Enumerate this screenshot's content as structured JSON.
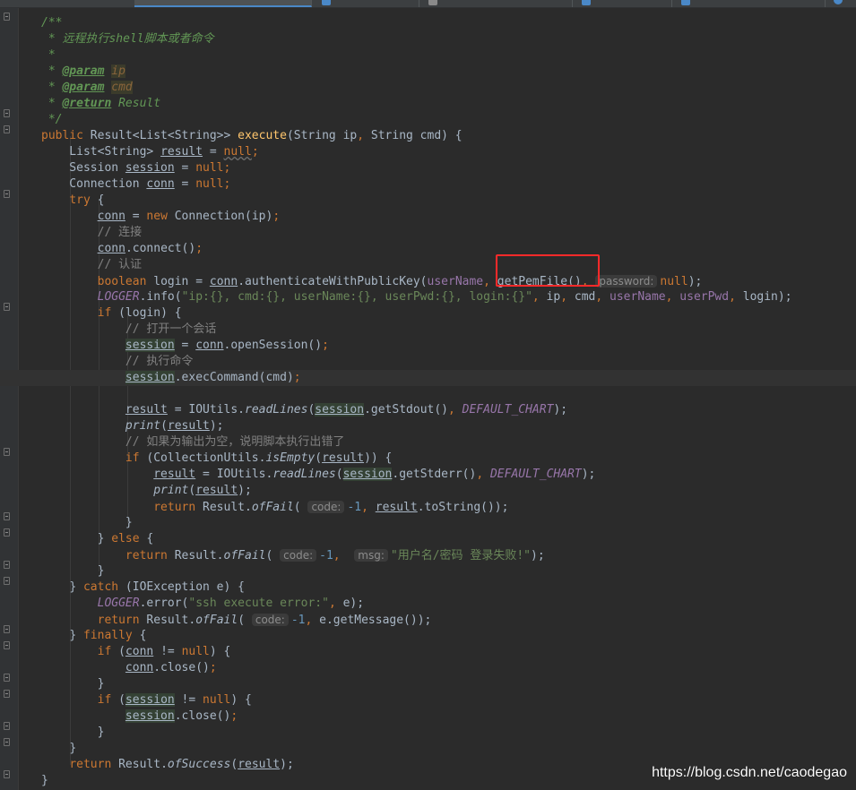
{
  "watermark": "https://blog.csdn.net/caodegao",
  "code": {
    "doc_open": "/**",
    "doc_desc_prefix": " * ",
    "doc_desc": "远程执行shell脚本或者命令",
    "doc_blank": " *",
    "doc_param_tag": "@param",
    "doc_param_ip": "ip",
    "doc_param_cmd": "cmd",
    "doc_return_tag": "@return",
    "doc_return_value": " Result",
    "doc_close": " */",
    "sig_public": "public",
    "sig_return_type": " Result<List<String>> ",
    "sig_name": "execute",
    "sig_params_a": "(String ip",
    "sig_comma": ",",
    "sig_params_b": " String cmd) {",
    "decl_result_type": "    List<String> ",
    "var_result": "result",
    "assign": " = ",
    "kw_null": "null",
    "semi": ";",
    "decl_session_type": "    Session ",
    "var_session": "session",
    "decl_conn_type": "    Connection ",
    "var_conn": "conn",
    "kw_try": "try",
    "brace_open": " {",
    "kw_new": "new",
    "ctor_connection": " Connection(ip)",
    "comment_connect": "// 连接",
    "call_connect": ".connect()",
    "comment_auth": "// 认证",
    "kw_boolean": "boolean",
    "login_decl": " login = ",
    "call_auth": ".authenticateWithPublicKey(",
    "param_username": "userName",
    "call_getpem": "getPemFile()",
    "hint_password": "password:",
    "close_paren_semi": ");",
    "const_logger": "LOGGER",
    "call_info": ".info(",
    "str_info": "\"ip:{}, cmd:{}, userName:{}, userPwd:{}, login:{}\"",
    "info_ip": " ip",
    "info_cmd": " cmd",
    "param_userpwd": "userPwd",
    "info_login": " login);",
    "kw_if": "if",
    "if_login": " (login) {",
    "comment_open_session": "// 打开一个会话",
    "call_open_session": ".openSession()",
    "comment_exec": "// 执行命令",
    "call_exec_command": ".execCommand(cmd)",
    "ioutils": "IOUtils.",
    "method_read_lines": "readLines",
    "call_get_stdout": ".getStdout()",
    "const_default_chart": "DEFAULT_CHART",
    "method_print": "print",
    "comment_empty_output": "// 如果为输出为空，说明脚本执行出错了",
    "collection_utils": " (CollectionUtils.",
    "method_is_empty": "isEmpty",
    "close_brace_paren": ")) {",
    "call_get_stderr": ".getStderr()",
    "kw_return": "return",
    "result_class": " Result.",
    "method_of_fail": "ofFail",
    "hint_code": "code:",
    "num_neg_one": "-1",
    "call_to_string": ".toString());",
    "brace_close": "}",
    "kw_else": "else",
    "hint_msg": "msg:",
    "str_login_fail": "\"用户名/密码 登录失败!\"",
    "kw_catch": "catch",
    "catch_clause": " (IOException e) {",
    "call_error": ".error(",
    "str_ssh_error": "\"ssh execute error:\"",
    "error_e": " e);",
    "get_message": " e.getMessage());",
    "kw_finally": "finally",
    "neq": " != ",
    "close_brace_open": ") {",
    "call_close": ".close()",
    "method_of_success": "ofSuccess"
  }
}
